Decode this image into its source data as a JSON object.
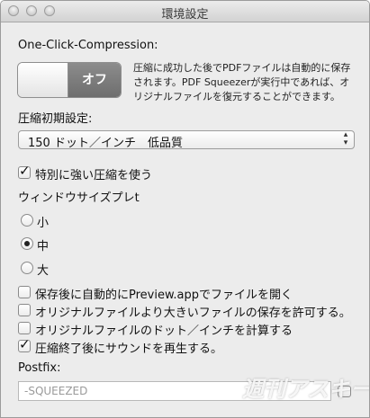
{
  "window": {
    "title": "環境設定"
  },
  "compression": {
    "heading": "One-Click-Compression:",
    "toggle_label": "オフ",
    "description_line1": "圧縮に成功した後でPDFファイルは自動的に保存",
    "description_line2": "されます。PDF Squeezerが実行中であれば、オ",
    "description_line3": "リジナルファイルを復元することができます。"
  },
  "initial_setting": {
    "label": "圧縮初期設定:",
    "selected": "150 ドット／インチ　低品質"
  },
  "strong_compression": {
    "label": "特別に強い圧縮を使う",
    "checked": true
  },
  "window_size": {
    "label": "ウィンドウサイズプレt",
    "options": [
      {
        "label": "小",
        "selected": false
      },
      {
        "label": "中",
        "selected": true
      },
      {
        "label": "大",
        "selected": false
      }
    ]
  },
  "options": [
    {
      "label": "保存後に自動的にPreview.appでファイルを開く",
      "checked": false
    },
    {
      "label": "オリジナルファイルより大きいファイルの保存を許可する。",
      "checked": false
    },
    {
      "label": "オリジナルファイルのドット／インチを計算する",
      "checked": false
    },
    {
      "label": "圧縮終了後にサウンドを再生する。",
      "checked": true
    }
  ],
  "postfix": {
    "label": "Postfix:",
    "value": "-SQUEEZED"
  },
  "watermark": "週刊アスキー"
}
